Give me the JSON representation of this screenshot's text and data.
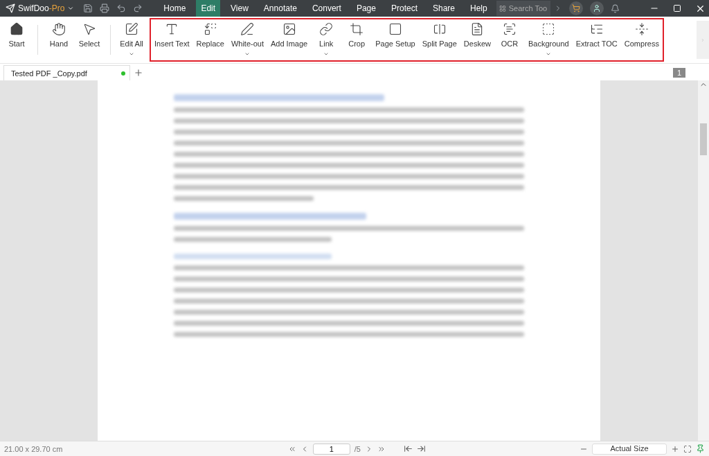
{
  "app": {
    "name": "SwifDoo",
    "suffix": "-Pro"
  },
  "menu": [
    {
      "label": "Home",
      "selected": false
    },
    {
      "label": "Edit",
      "selected": true
    },
    {
      "label": "View",
      "selected": false
    },
    {
      "label": "Annotate",
      "selected": false
    },
    {
      "label": "Convert",
      "selected": false
    },
    {
      "label": "Page",
      "selected": false
    },
    {
      "label": "Protect",
      "selected": false
    },
    {
      "label": "Share",
      "selected": false
    },
    {
      "label": "Help",
      "selected": false
    }
  ],
  "search": {
    "placeholder": "Search Too"
  },
  "toolbar": {
    "groups": [
      {
        "highlighted": false,
        "tools": [
          {
            "kind": "home",
            "label": "Start",
            "dropdown": false
          }
        ]
      },
      {
        "highlighted": false,
        "tools": [
          {
            "kind": "hand",
            "label": "Hand",
            "dropdown": false
          },
          {
            "kind": "pointer",
            "label": "Select",
            "dropdown": false
          }
        ]
      },
      {
        "highlighted": false,
        "tools": [
          {
            "kind": "edit",
            "label": "Edit All",
            "dropdown": true
          }
        ]
      },
      {
        "highlighted": true,
        "tools": [
          {
            "kind": "text",
            "label": "Insert Text",
            "dropdown": false
          },
          {
            "kind": "replace",
            "label": "Replace",
            "dropdown": false
          },
          {
            "kind": "pen",
            "label": "White-out",
            "dropdown": true
          },
          {
            "kind": "image",
            "label": "Add Image",
            "dropdown": false
          },
          {
            "kind": "link",
            "label": "Link",
            "dropdown": true
          },
          {
            "kind": "crop",
            "label": "Crop",
            "dropdown": false
          },
          {
            "kind": "page",
            "label": "Page Setup",
            "dropdown": false
          },
          {
            "kind": "split",
            "label": "Split Page",
            "dropdown": false
          },
          {
            "kind": "deskew",
            "label": "Deskew",
            "dropdown": false
          },
          {
            "kind": "ocr",
            "label": "OCR",
            "dropdown": false
          },
          {
            "kind": "background",
            "label": "Background",
            "dropdown": true
          },
          {
            "kind": "toc",
            "label": "Extract TOC",
            "dropdown": false
          },
          {
            "kind": "compress",
            "label": "Compress",
            "dropdown": false
          }
        ]
      }
    ]
  },
  "tabs": [
    {
      "label": "Tested PDF _Copy.pdf",
      "selected": true,
      "modified": true
    }
  ],
  "page_badge": "1",
  "status": {
    "size": "21.00 x 29.70 cm",
    "page": "1",
    "total": "/5",
    "zoom": "Actual Size"
  }
}
